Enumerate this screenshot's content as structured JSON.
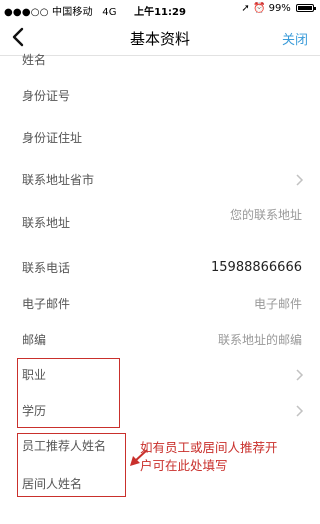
{
  "status_bar": {
    "carrier": "●●●○○ 中国移动",
    "network": "4G",
    "time": "上午11:29",
    "battery": "99%"
  },
  "nav": {
    "title": "基本资料",
    "close_label": "关闭"
  },
  "form": {
    "name_label": "姓名",
    "id_number_label": "身份证号",
    "id_address_label": "身份证住址",
    "province_label": "联系地址省市",
    "address_label": "联系地址",
    "address_placeholder": "您的联系地址",
    "phone_label": "联系电话",
    "phone_value": "15988866666",
    "email_label": "电子邮件",
    "email_placeholder": "电子邮件",
    "zip_label": "邮编",
    "zip_placeholder": "联系地址的邮编",
    "occupation_label": "职业",
    "education_label": "学历",
    "employee_referrer_label": "员工推荐人姓名",
    "broker_name_label": "居间人姓名"
  },
  "annotation": {
    "line1": "如有员工或居间人推荐开",
    "line2": "户可在此处填写"
  },
  "colors": {
    "accent": "#3a9bd9",
    "annotation": "#c9302c"
  }
}
